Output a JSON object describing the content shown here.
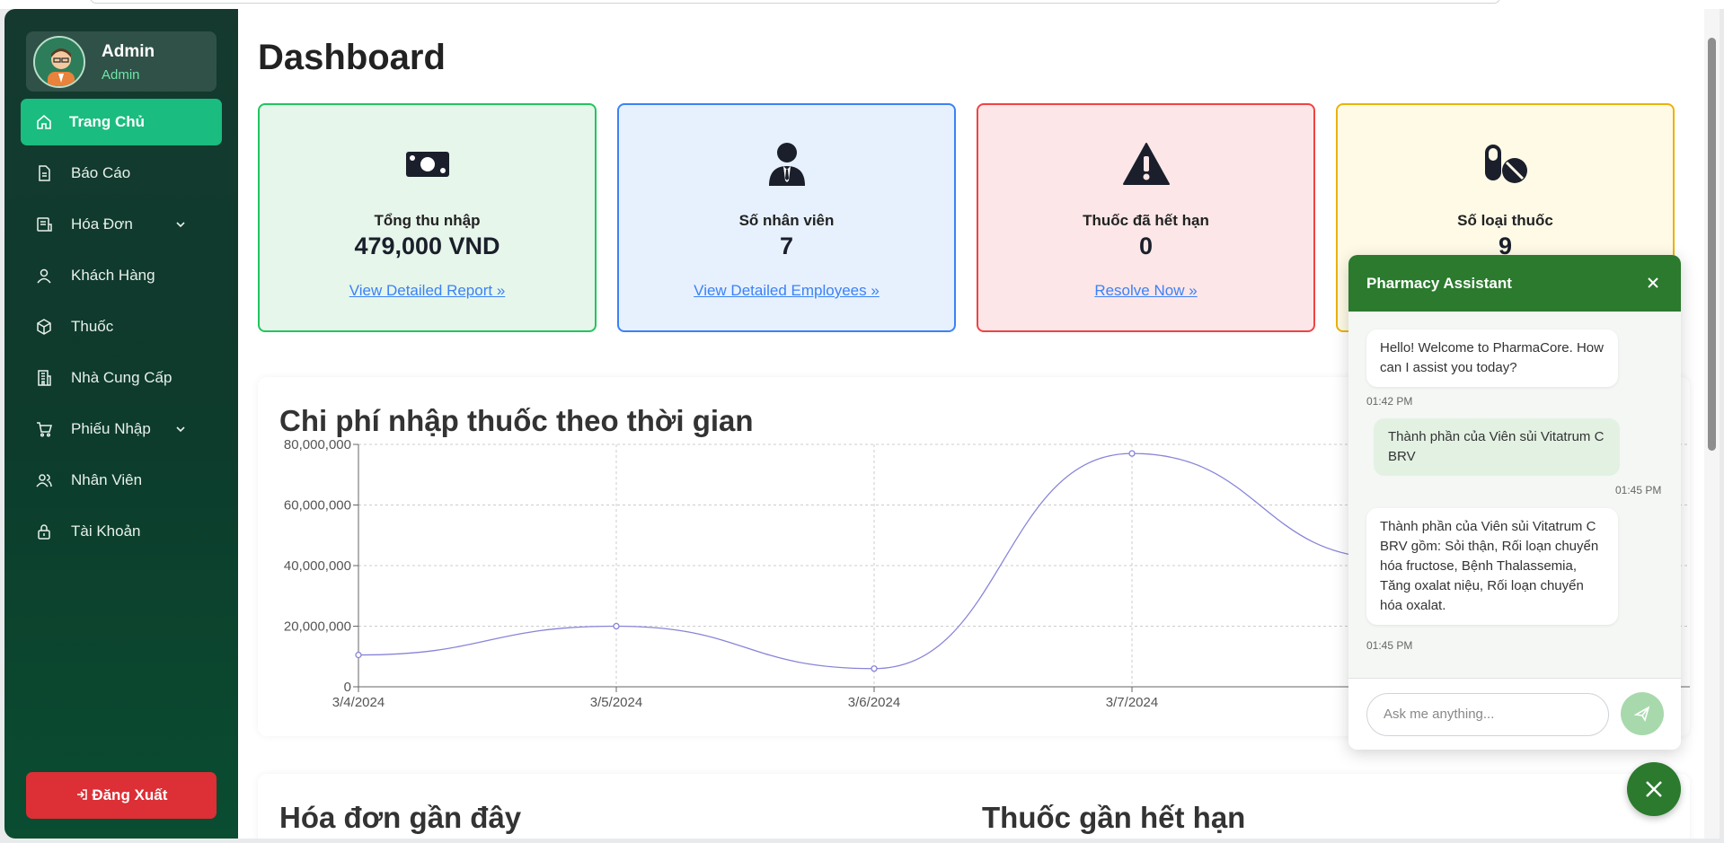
{
  "sidebar": {
    "profile": {
      "name": "Admin",
      "role": "Admin"
    },
    "items": [
      {
        "label": "Trang Chủ",
        "icon": "home-icon"
      },
      {
        "label": "Báo Cáo",
        "icon": "document-icon"
      },
      {
        "label": "Hóa Đơn",
        "icon": "receipt-icon"
      },
      {
        "label": "Khách Hàng",
        "icon": "user-icon"
      },
      {
        "label": "Thuốc",
        "icon": "box-icon"
      },
      {
        "label": "Nhà Cung Cấp",
        "icon": "building-icon"
      },
      {
        "label": "Phiếu Nhập",
        "icon": "cart-icon"
      },
      {
        "label": "Nhân Viên",
        "icon": "users-icon"
      },
      {
        "label": "Tài Khoản",
        "icon": "lock-icon"
      }
    ],
    "logout": "Đăng Xuất"
  },
  "page": {
    "title": "Dashboard"
  },
  "cards": [
    {
      "label": "Tổng thu nhập",
      "value": "479,000 VND",
      "link": "View Detailed Report »",
      "icon": "money-icon",
      "border": "#22c55e",
      "bg": "#e6f6ea"
    },
    {
      "label": "Số nhân viên",
      "value": "7",
      "link": "View Detailed Employees »",
      "icon": "employee-icon",
      "border": "#3b82f6",
      "bg": "#e7f1fd"
    },
    {
      "label": "Thuốc đã hết hạn",
      "value": "0",
      "link": "Resolve Now »",
      "icon": "warning-icon",
      "border": "#ef4444",
      "bg": "#fde6e7"
    },
    {
      "label": "Số loại thuốc",
      "value": "9",
      "link": "",
      "icon": "pills-icon",
      "border": "#eab308",
      "bg": "#fefae6"
    }
  ],
  "chart_data": {
    "type": "line",
    "title": "Chi phí nhập thuốc theo thời gian",
    "x": [
      "3/4/2024",
      "3/5/2024",
      "3/6/2024",
      "3/7/2024"
    ],
    "values": [
      10500000,
      20000000,
      6000000,
      77000000
    ],
    "yticks": [
      "0",
      "20,000,000",
      "40,000,000",
      "60,000,000",
      "80,000,000"
    ],
    "ylim": [
      0,
      80000000
    ],
    "grid": true,
    "color": "#8884d8"
  },
  "bottom": {
    "invoices_title": "Hóa đơn gần đây",
    "expiring_title": "Thuốc gần hết hạn"
  },
  "chat": {
    "title": "Pharmacy Assistant",
    "messages": [
      {
        "from": "bot",
        "text": "Hello! Welcome to PharmaCore. How can I assist you today?",
        "time": "01:42 PM"
      },
      {
        "from": "user",
        "text": "Thành phần của Viên sủi Vitatrum C BRV",
        "time": "01:45 PM"
      },
      {
        "from": "bot",
        "text": "Thành phần của Viên sủi Vitatrum C BRV gồm: Sỏi thận, Rối loạn chuyển hóa fructose, Bệnh Thalassemia, Tăng oxalat niệu, Rối loạn chuyển hóa oxalat.",
        "time": "01:45 PM"
      }
    ],
    "input_placeholder": "Ask me anything..."
  }
}
